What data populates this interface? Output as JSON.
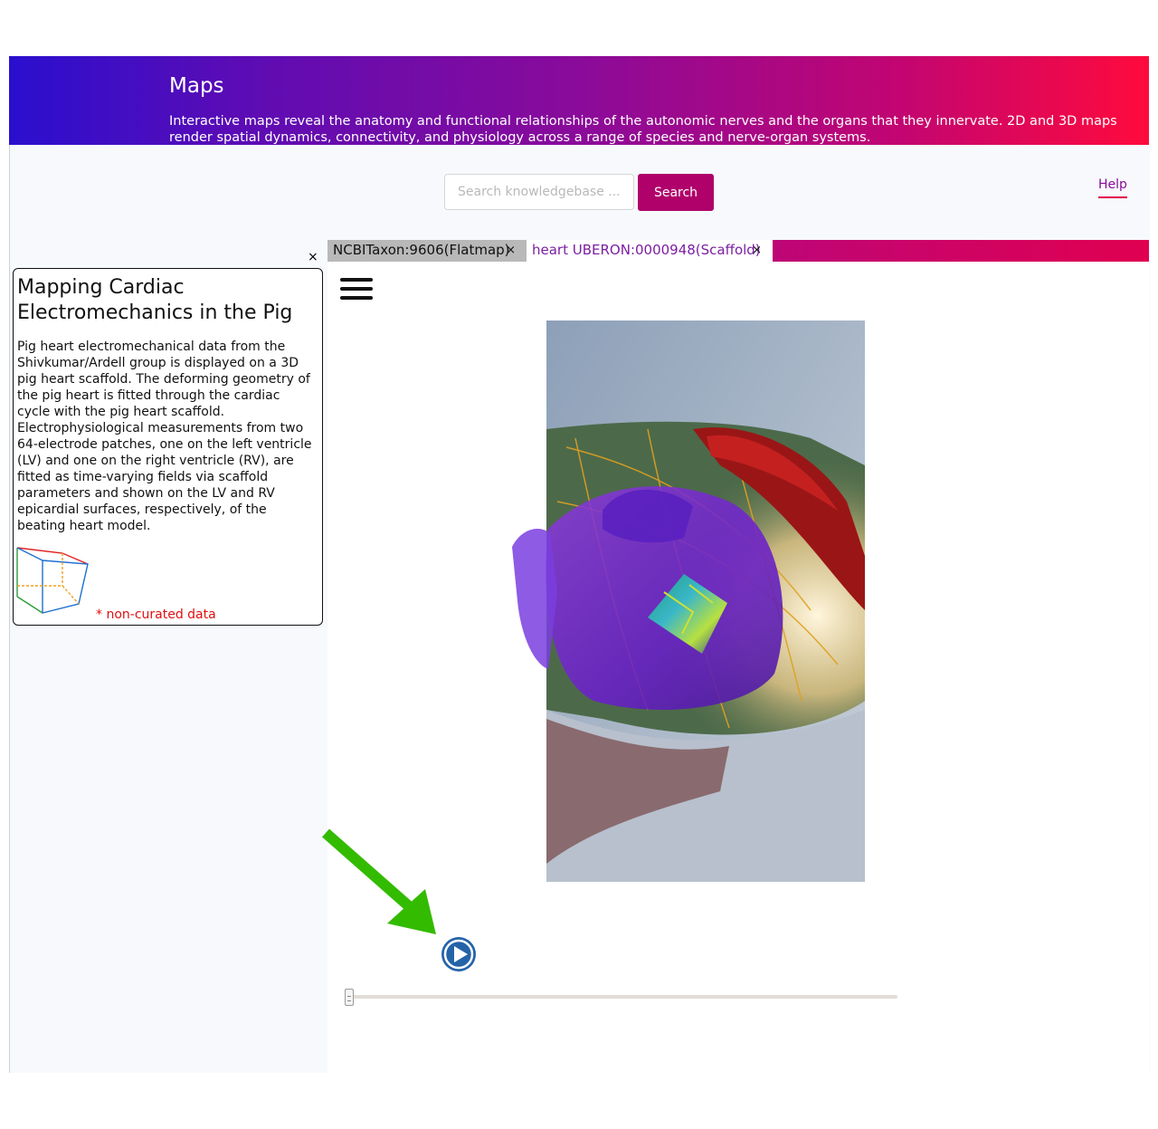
{
  "header": {
    "title": "Maps",
    "description": "Interactive maps reveal the anatomy and functional relationships of the autonomic nerves and the organs that they innervate. 2D and 3D maps render spatial dynamics, connectivity, and physiology across a range of species and nerve-organ systems."
  },
  "search": {
    "placeholder": "Search knowledgebase ...",
    "button_label": "Search"
  },
  "help_label": "Help",
  "close_glyph": "×",
  "tabs": [
    {
      "label": "NCBITaxon:9606(Flatmap)",
      "active": false
    },
    {
      "label": "heart UBERON:0000948(Scaffold)",
      "active": true
    }
  ],
  "info": {
    "title": "Mapping Cardiac Electromechanics in the Pig",
    "description": "Pig heart electromechanical data from the Shivkumar/Ardell group is displayed on a 3D pig heart scaffold. The deforming geometry of the pig heart is fitted through the cardiac cycle with the pig heart scaffold. Electrophysiological measurements from two 64-electrode patches, one on the left ventricle (LV) and one on the right ventricle (RV), are fitted as time-varying fields via scaffold parameters and shown on the LV and RV epicardial surfaces, respectively, of the beating heart model.",
    "note": "* non-curated data"
  },
  "timeline": {
    "position": 0.0
  },
  "colors": {
    "banner_start": "#2a0fcf",
    "banner_end": "#ff0a3c",
    "search_button": "#b0006a",
    "active_tab_text": "#7b1fa2",
    "play_button": "#2563a8",
    "note": "#e01010",
    "annotation_arrow": "#33bb00"
  }
}
